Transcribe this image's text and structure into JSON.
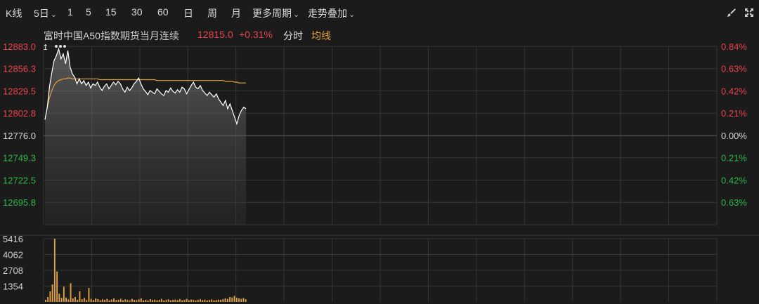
{
  "toolbar": {
    "kline": "K线",
    "period_5d": "5日",
    "periods": [
      "1",
      "5",
      "15",
      "30",
      "60",
      "日",
      "周",
      "月"
    ],
    "more_periods": "更多周期",
    "overlay": "走势叠加",
    "icons": [
      "draw-brush-icon",
      "expand-arrows-icon"
    ]
  },
  "info": {
    "name": "富时中国A50指数期货当月连续",
    "price": "12815.0",
    "change": "+0.31%",
    "mode": "分时",
    "avg_label": "均线",
    "colors": {
      "name": "#d0d0d0",
      "price": "#e8434b",
      "mode": "#e0e0e0",
      "avg": "#e2a23e"
    }
  },
  "chart_data": [
    {
      "type": "line",
      "y_ticks_left": [
        "12883.0",
        "12856.3",
        "12829.5",
        "12802.8",
        "12776.0",
        "12749.3",
        "12722.5",
        "12695.8"
      ],
      "y_ticks_right": [
        "0.84%",
        "0.63%",
        "0.42%",
        "0.21%",
        "0.00%",
        "0.21%",
        "0.42%",
        "0.63%"
      ],
      "ylim": [
        12669,
        12883
      ],
      "base": 12776.0,
      "grid": true,
      "colors": {
        "up": "#e8434b",
        "down": "#2fb34a",
        "base": "#d8d8d8",
        "price_line": "#ffffff",
        "avg_line": "#e2a23e"
      },
      "series": [
        {
          "values": [
            12795,
            12810,
            12835,
            12852,
            12866,
            12872,
            12880,
            12868,
            12874,
            12862,
            12878,
            12858,
            12850,
            12846,
            12838,
            12844,
            12838,
            12842,
            12836,
            12840,
            12833,
            12838,
            12836,
            12840,
            12834,
            12830,
            12835,
            12838,
            12832,
            12836,
            12840,
            12837,
            12841,
            12838,
            12832,
            12828,
            12834,
            12830,
            12833,
            12838,
            12841,
            12845,
            12838,
            12832,
            12829,
            12825,
            12830,
            12828,
            12826,
            12832,
            12829,
            12826,
            12824,
            12830,
            12828,
            12833,
            12829,
            12827,
            12831,
            12828,
            12834,
            12832,
            12826,
            12831,
            12836,
            12840,
            12834,
            12832,
            12836,
            12830,
            12827,
            12824,
            12828,
            12825,
            12822,
            12826,
            12820,
            12816,
            12812,
            12818,
            12808,
            12814,
            12806,
            12798,
            12790,
            12800,
            12806,
            12810,
            12808
          ],
          "avg_values": [
            12795,
            12810,
            12822,
            12830,
            12836,
            12840,
            12842,
            12843,
            12844,
            12844,
            12845,
            12845,
            12844,
            12844,
            12844,
            12844,
            12844,
            12844,
            12844,
            12844,
            12844,
            12844,
            12844,
            12844,
            12843,
            12843,
            12843,
            12843,
            12843,
            12843,
            12843,
            12843,
            12843,
            12843,
            12843,
            12843,
            12843,
            12843,
            12843,
            12843,
            12843,
            12843,
            12843,
            12843,
            12843,
            12843,
            12843,
            12843,
            12843,
            12842,
            12842,
            12842,
            12842,
            12842,
            12842,
            12842,
            12842,
            12842,
            12842,
            12842,
            12842,
            12842,
            12842,
            12842,
            12842,
            12842,
            12842,
            12842,
            12842,
            12842,
            12842,
            12842,
            12842,
            12842,
            12842,
            12842,
            12842,
            12842,
            12842,
            12841,
            12841,
            12841,
            12841,
            12840,
            12840,
            12839,
            12839,
            12839,
            12839
          ]
        }
      ]
    },
    {
      "type": "bar",
      "y_ticks_left": [
        "5416",
        "4062",
        "2708",
        "1354"
      ],
      "ylim": [
        0,
        5416
      ],
      "colors": {
        "bar": "#e2a23e"
      },
      "values": [
        180,
        420,
        900,
        1500,
        5416,
        2600,
        700,
        350,
        1300,
        380,
        220,
        1600,
        300,
        420,
        180,
        900,
        220,
        350,
        150,
        1200,
        260,
        160,
        300,
        240,
        140,
        220,
        180,
        260,
        120,
        200,
        300,
        150,
        180,
        260,
        140,
        220,
        160,
        120,
        260,
        180,
        150,
        220,
        300,
        140,
        180,
        120,
        240,
        160,
        200,
        140,
        180,
        260,
        120,
        160,
        220,
        140,
        180,
        200,
        150,
        240,
        130,
        170,
        260,
        140,
        200,
        160,
        120,
        180,
        240,
        150,
        190,
        130,
        170,
        220,
        140,
        160,
        200,
        180,
        240,
        300,
        260,
        420,
        380,
        520,
        360,
        300,
        260,
        340,
        220
      ]
    }
  ]
}
